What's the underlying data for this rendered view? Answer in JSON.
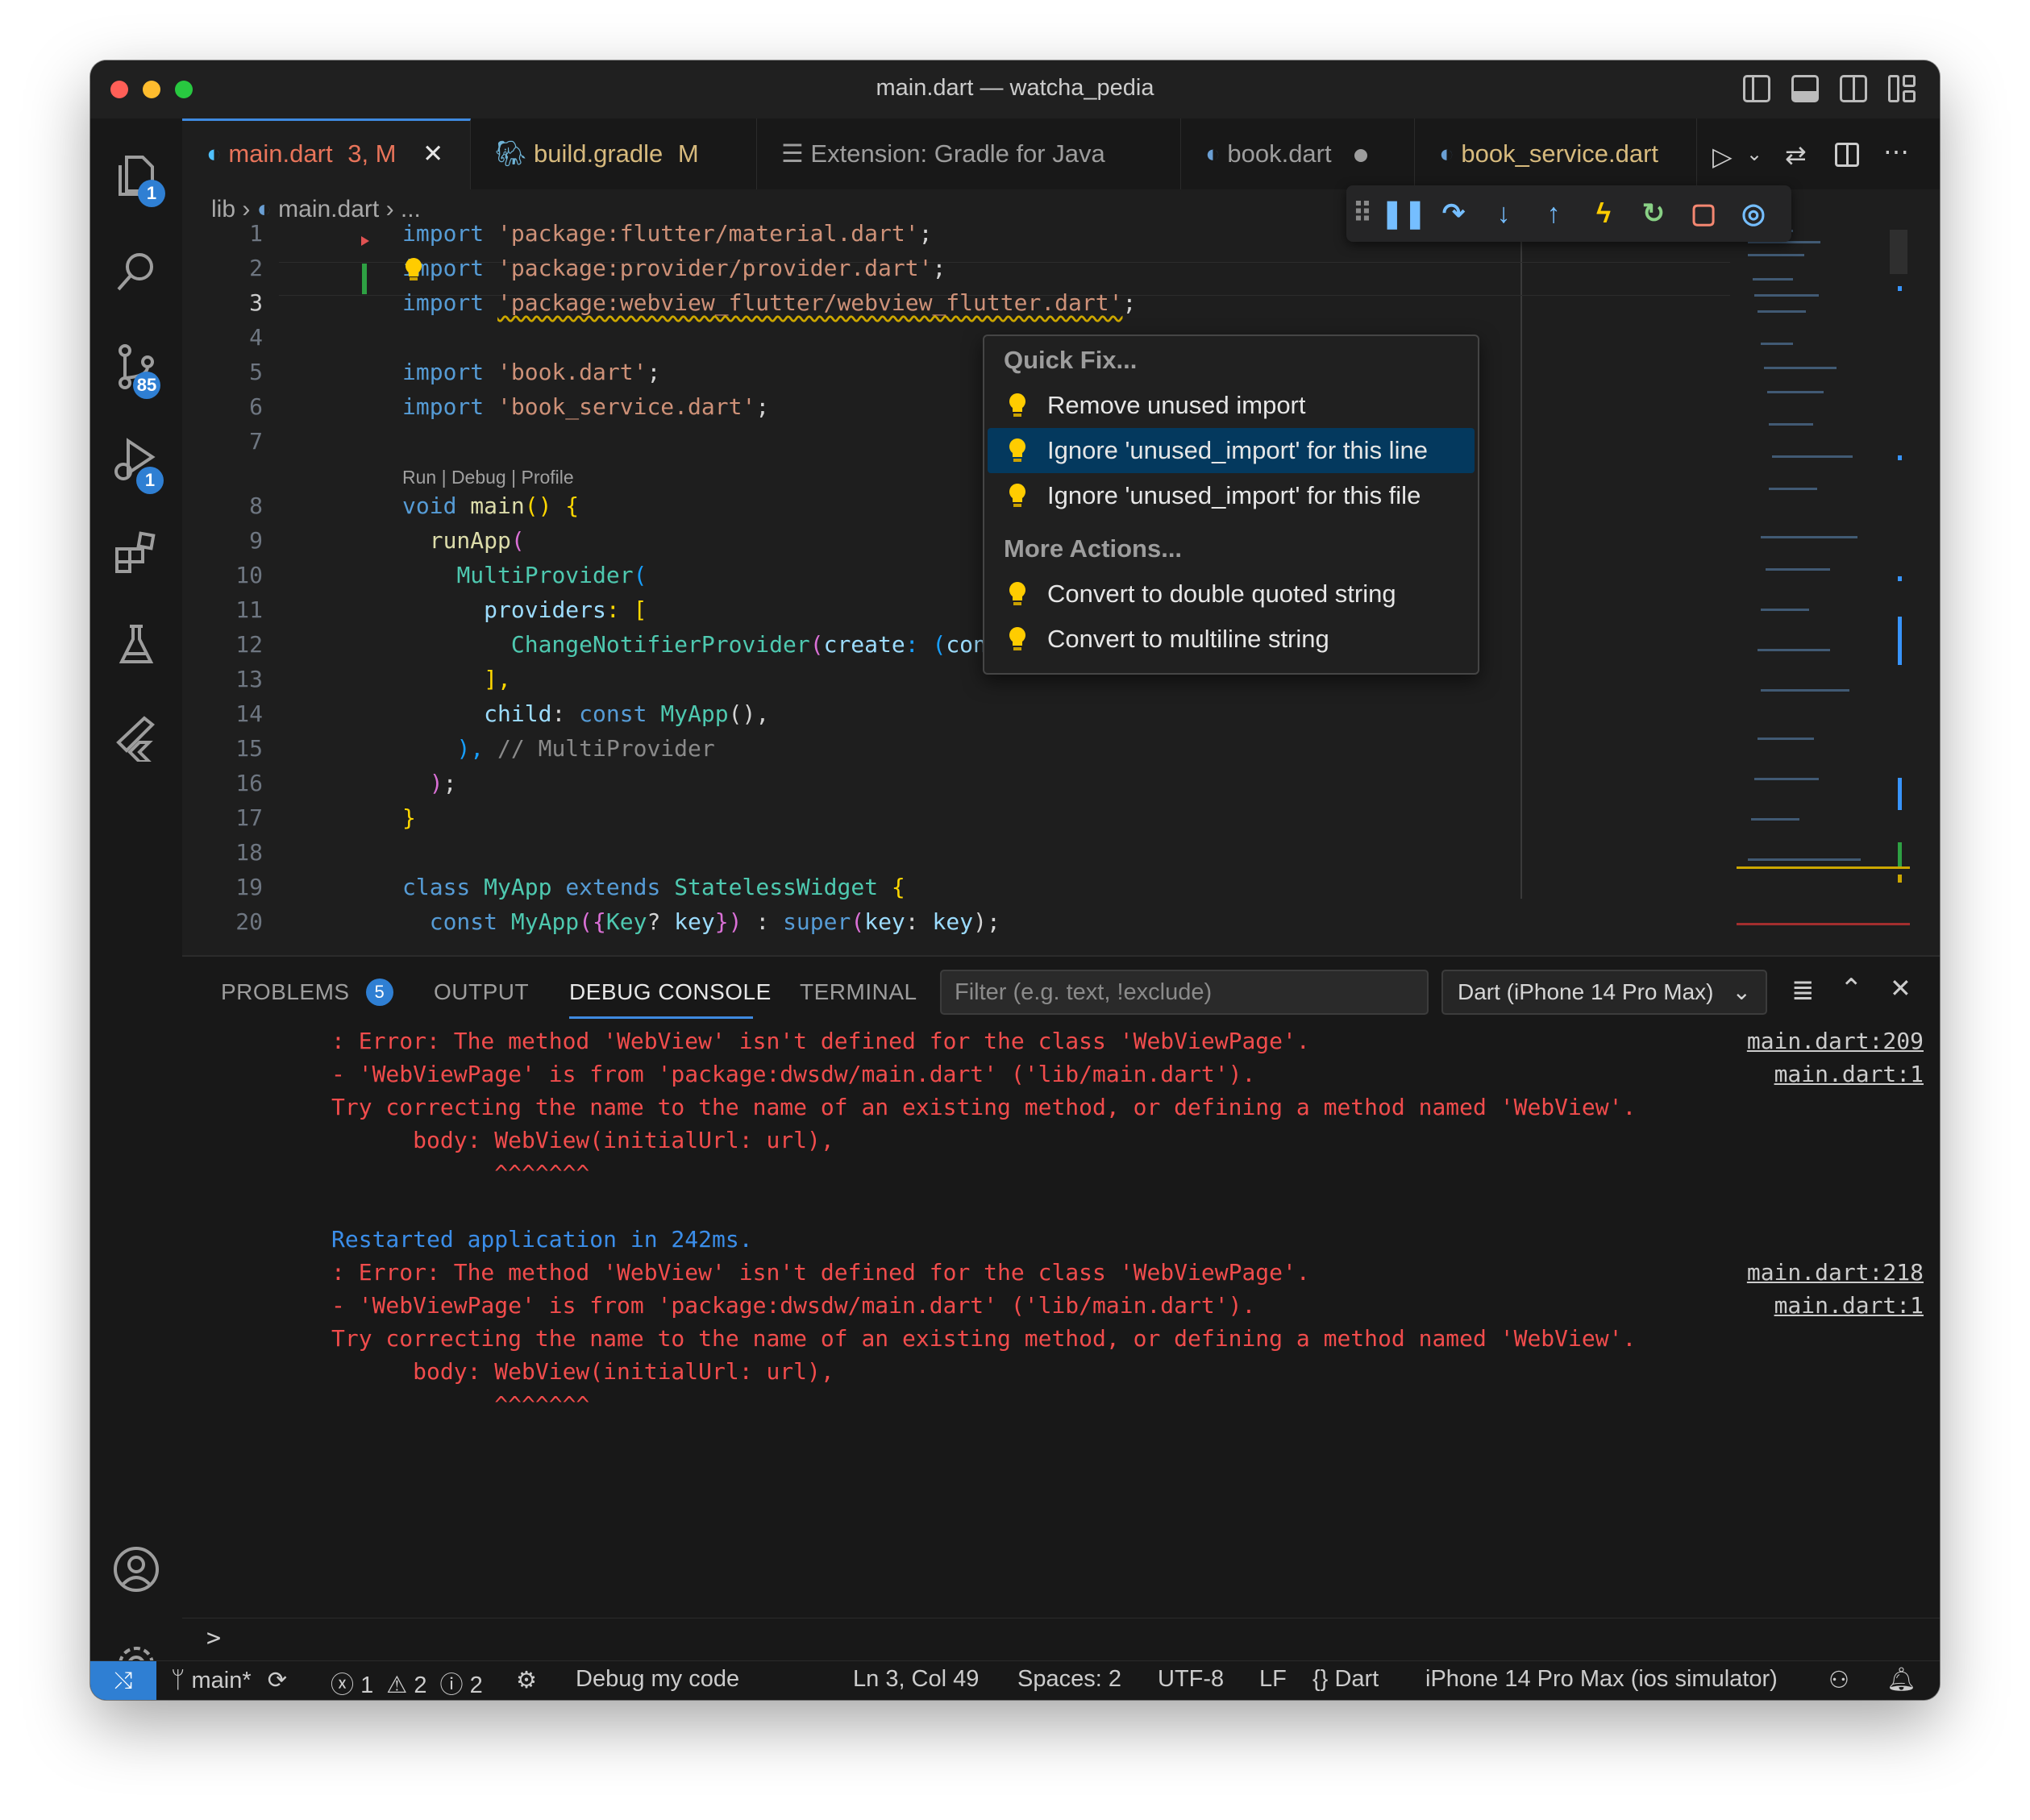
{
  "window": {
    "title": "main.dart — watcha_pedia"
  },
  "activity": {
    "explorer_badge": "1",
    "scm_badge": "85",
    "debug_badge": "1"
  },
  "tabs": [
    {
      "label": "main.dart",
      "status": "3, M"
    },
    {
      "label": "build.gradle",
      "status": "M"
    },
    {
      "label": "Extension: Gradle for Java"
    },
    {
      "label": "book.dart"
    },
    {
      "label": "book_service.dart"
    }
  ],
  "breadcrumb": {
    "folder": "lib",
    "file": "main.dart",
    "more": "..."
  },
  "editor": {
    "line_numbers": [
      "1",
      "2",
      "3",
      "4",
      "5",
      "6",
      "7",
      "8",
      "9",
      "10",
      "11",
      "12",
      "13",
      "14",
      "15",
      "16",
      "17",
      "18",
      "19",
      "20"
    ],
    "codelens": "Run | Debug | Profile",
    "line1": {
      "kw": "import",
      "str": "'package:flutter/material.dart'",
      "end": ";"
    },
    "line2": {
      "kw": "import",
      "str": "'package:provider/provider.dart'",
      "end": ";"
    },
    "line3": {
      "kw": "import",
      "str": "'package:webview_flutter/webview_flutter.dart'",
      "end": ";"
    },
    "line5": {
      "kw": "import",
      "str": "'book.dart'",
      "end": ";"
    },
    "line6": {
      "kw": "import",
      "str": "'book_service.dart'",
      "end": ";"
    },
    "line8": {
      "kw": "void",
      "fn": "main",
      "rest": "() {"
    },
    "line9": {
      "fn": "runApp",
      "p": "("
    },
    "line10": {
      "cls": "MultiProvider",
      "p": "("
    },
    "line11": {
      "var": "providers",
      "rest": ": ["
    },
    "line12": {
      "cls": "ChangeNotifierProvider",
      "p": "(",
      "var": "create",
      "rest": ": (",
      "var2": "context",
      "p2": ")"
    },
    "line13": {
      "rest": "],"
    },
    "line14": {
      "var": "child",
      "rest": ": ",
      "kw": "const",
      "cls": "MyApp",
      "end": "(),"
    },
    "line15": {
      "p": "),",
      "cmt": "// MultiProvider"
    },
    "line16": {
      "p": ")",
      "end": ";"
    },
    "line17": {
      "p": "}"
    },
    "line19": {
      "kw": "class",
      "cls": "MyApp",
      "kw2": "extends",
      "cls2": "StatelessWidget",
      "p": "{"
    },
    "line20": {
      "kw": "const",
      "cls": "MyApp",
      "p": "({",
      "cls2": "Key",
      "q": "?",
      "var": "key",
      "p2": "})",
      "sep": " : ",
      "kw2": "super",
      "p3": "(",
      "var2": "key",
      "colon": ": ",
      "var3": "key",
      "end": ");"
    }
  },
  "quickfix": {
    "heading": "Quick Fix...",
    "items": [
      "Remove unused import",
      "Ignore 'unused_import' for this line",
      "Ignore 'unused_import' for this file"
    ],
    "more_heading": "More Actions...",
    "more_items": [
      "Convert to double quoted string",
      "Convert to multiline string"
    ]
  },
  "panel": {
    "tabs": [
      "PROBLEMS",
      "OUTPUT",
      "DEBUG CONSOLE",
      "TERMINAL"
    ],
    "problems_count": "5",
    "filter_placeholder": "Filter (e.g. text, !exclude)",
    "device_select": "Dart (iPhone 14 Pro Max)",
    "prompt": ">"
  },
  "console": {
    "block1": [
      ": Error: The method 'WebView' isn't defined for the class 'WebViewPage'.",
      "- 'WebViewPage' is from 'package:dwsdw/main.dart' ('lib/main.dart').",
      "Try correcting the name to the name of an existing method, or defining a method named 'WebView'.",
      "      body: WebView(initialUrl: url),",
      "            ^^^^^^^"
    ],
    "block1_links": [
      "main.dart:209",
      "main.dart:1"
    ],
    "restarted": "Restarted application in 242ms.",
    "block2": [
      ": Error: The method 'WebView' isn't defined for the class 'WebViewPage'.",
      "- 'WebViewPage' is from 'package:dwsdw/main.dart' ('lib/main.dart').",
      "Try correcting the name to the name of an existing method, or defining a method named 'WebView'.",
      "      body: WebView(initialUrl: url),",
      "            ^^^^^^^"
    ],
    "block2_links": [
      "main.dart:218",
      "main.dart:1"
    ]
  },
  "status": {
    "branch": "main*",
    "errors": "1",
    "warnings": "2",
    "infos": "2",
    "debug": "Debug my code",
    "position": "Ln 3, Col 49",
    "spaces": "Spaces: 2",
    "encoding": "UTF-8",
    "eol": "LF",
    "language": "Dart",
    "device": "iPhone 14 Pro Max (ios simulator)"
  },
  "colors": {
    "accent": "#2f7fd3",
    "error": "#f14c4c",
    "info": "#3b8eea",
    "modified": "#d7ba7d",
    "tab_active": "#e8745a"
  }
}
